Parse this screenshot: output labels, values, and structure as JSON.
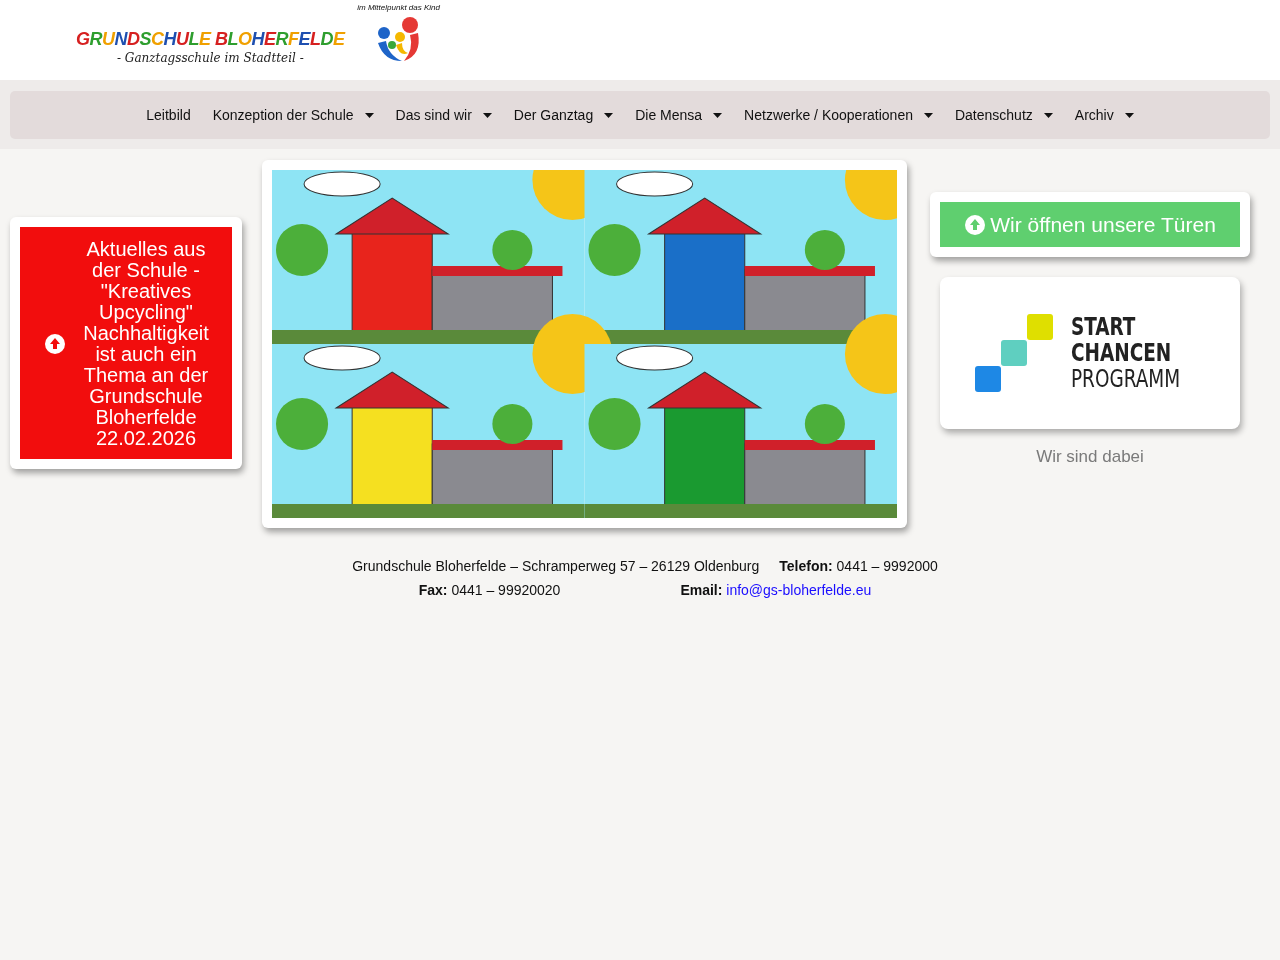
{
  "header": {
    "logo": {
      "title": "GRUNDSCHULE BLOHERFELDE",
      "subtitle": "- Ganztagsschule im Stadtteil -",
      "motto": "im Mittelpunkt das Kind"
    }
  },
  "nav": {
    "items": [
      {
        "label": "Leitbild",
        "has_dropdown": false
      },
      {
        "label": "Konzeption der Schule",
        "has_dropdown": true
      },
      {
        "label": "Das sind wir",
        "has_dropdown": true
      },
      {
        "label": "Der Ganztag",
        "has_dropdown": true
      },
      {
        "label": "Die Mensa",
        "has_dropdown": true
      },
      {
        "label": "Netzwerke / Kooperationen",
        "has_dropdown": true
      },
      {
        "label": "Datenschutz",
        "has_dropdown": true
      },
      {
        "label": "Archiv",
        "has_dropdown": true
      }
    ]
  },
  "left_panel": {
    "button": "Aktuelles aus der Schule - \"Kreatives Upcycling\" Nachhaltigkeit ist auch ein Thema an der Grundschule Bloherfelde 22.02.2026"
  },
  "right_panel": {
    "button": "Wir öffnen unsere Türen",
    "logo": {
      "lines": [
        "START",
        "CHANCEN",
        "PROGRAMM"
      ]
    },
    "caption": "Wir sind dabei"
  },
  "footer": {
    "lines": [
      [
        {
          "kind": "text",
          "text": "Grundschule Bloherfelde – Schramperweg 57 – 26129 Oldenburg"
        },
        {
          "kind": "labeled",
          "label": "Telefon:",
          "value": "0441 – 9992000"
        }
      ],
      [
        {
          "kind": "labeled",
          "label": "Fax:",
          "value": "0441 – 99920020"
        },
        {
          "kind": "link",
          "label": "Email:",
          "value": "info@gs-bloherfelde.eu"
        }
      ]
    ]
  }
}
